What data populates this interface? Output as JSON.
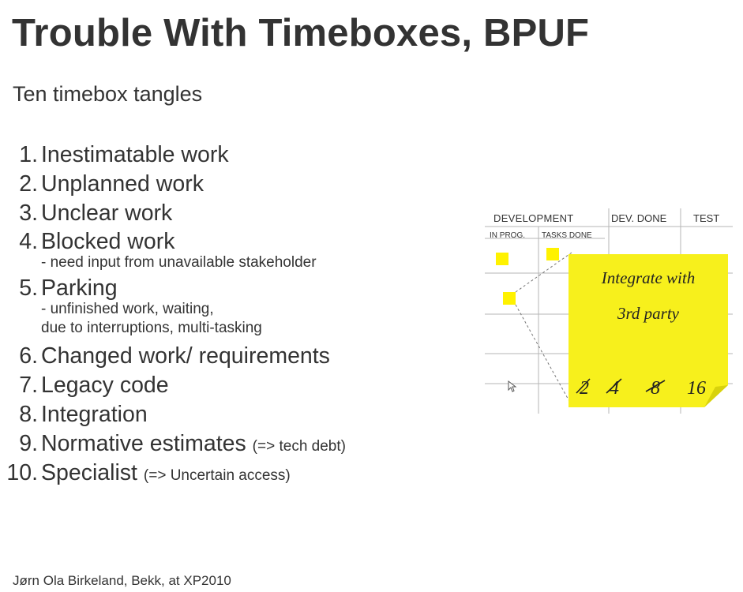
{
  "title": "Trouble With Timeboxes, BPUF",
  "subtitle": "Ten timebox tangles",
  "items": [
    {
      "num": "1.",
      "text": "Inestimatable work"
    },
    {
      "num": "2.",
      "text": "Unplanned work"
    },
    {
      "num": "3.",
      "text": "Unclear work"
    },
    {
      "num": "4.",
      "text": "Blocked work",
      "note": "- need input from unavailable stakeholder"
    },
    {
      "num": "5.",
      "text": "Parking",
      "note_line1": "- unfinished work, waiting,",
      "note_line2": "due to interruptions, multi-tasking"
    },
    {
      "num": "6.",
      "text": "Changed work/ requirements"
    },
    {
      "num": "7.",
      "text": "Legacy code"
    },
    {
      "num": "8.",
      "text": "Integration"
    },
    {
      "num": "9.",
      "text": "Normative estimates",
      "aside": "(=> tech debt)"
    },
    {
      "num": "10.",
      "text": "Specialist",
      "aside": "(=> Uncertain access)"
    }
  ],
  "board": {
    "columns": [
      "DEVELOPMENT",
      "DEV. DONE",
      "TEST"
    ],
    "subcolumns": [
      "IN PROG.",
      "TASKS DONE"
    ],
    "note_line1": "Integrate with",
    "note_line2": "3rd party",
    "estimates": [
      "2",
      "4",
      "8",
      "16"
    ],
    "note_color": "#f7f01c",
    "square_color": "#fff200"
  },
  "footer": "Jørn Ola Birkeland, Bekk, at XP2010"
}
